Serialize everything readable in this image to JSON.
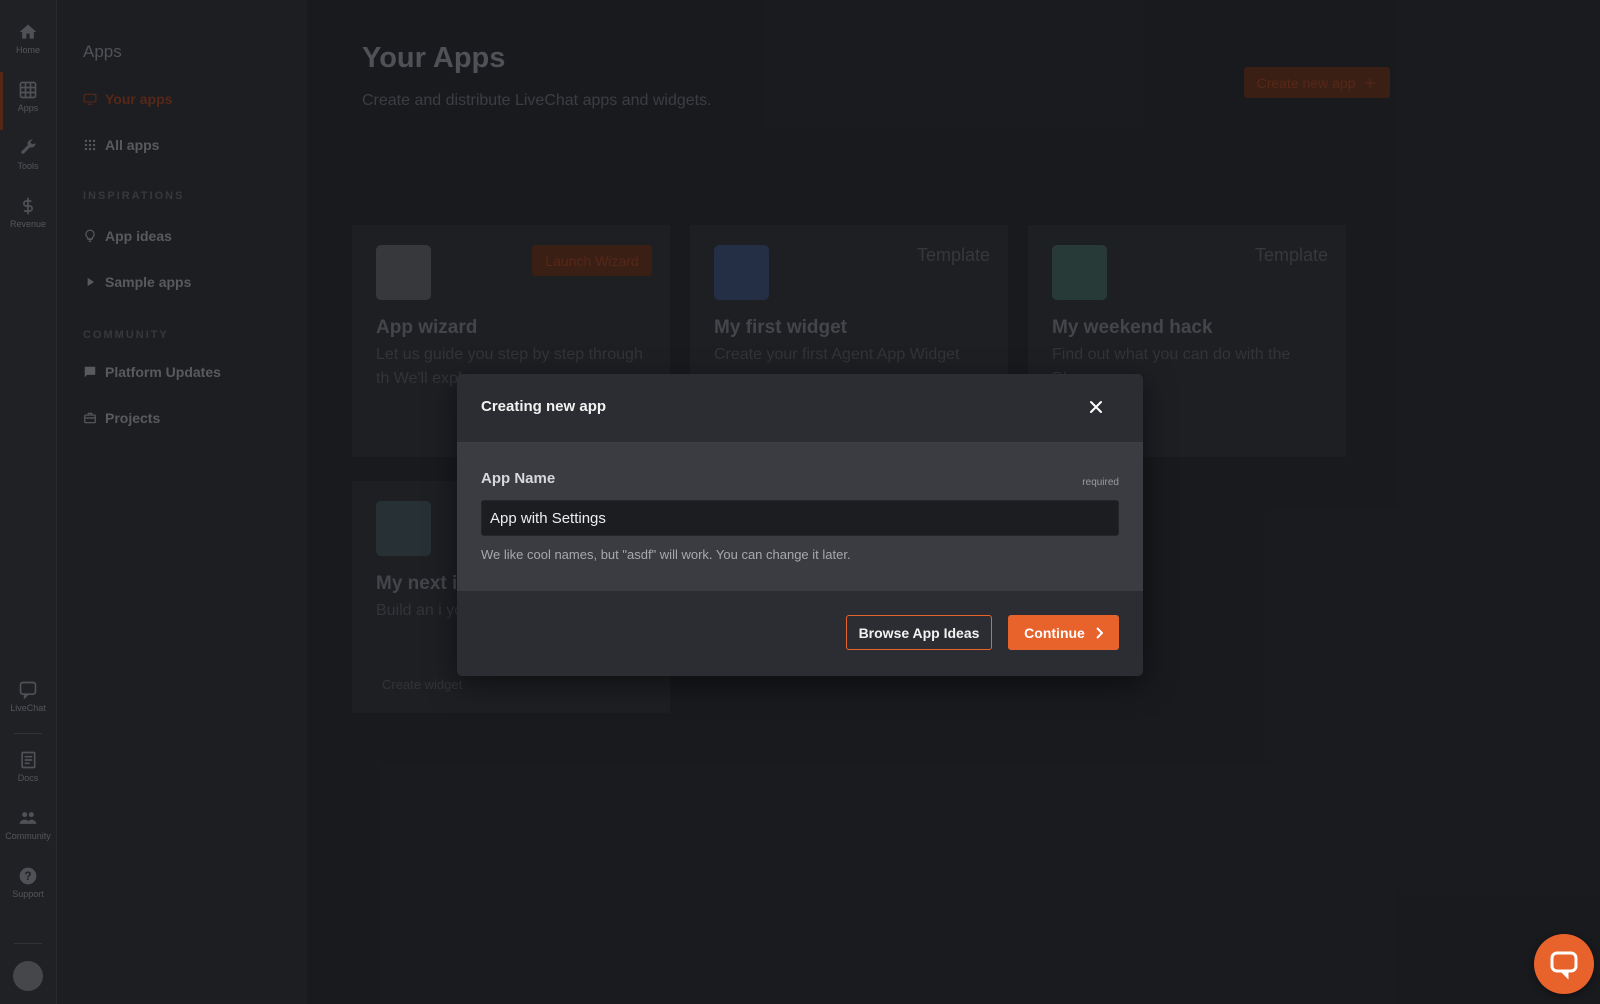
{
  "rail": {
    "items": [
      {
        "label": "Home",
        "icon": "home-icon"
      },
      {
        "label": "Apps",
        "icon": "apps-grid-icon"
      },
      {
        "label": "Tools",
        "icon": "wrench-icon"
      },
      {
        "label": "Revenue",
        "icon": "dollar-icon"
      },
      {
        "label": "LiveChat",
        "icon": "chat-icon"
      },
      {
        "label": "Docs",
        "icon": "docs-icon"
      },
      {
        "label": "Community",
        "icon": "people-icon"
      },
      {
        "label": "Support",
        "icon": "help-icon"
      }
    ]
  },
  "nav": {
    "title": "Apps",
    "your_apps": "Your apps",
    "all_apps": "All apps",
    "inspirations_heading": "INSPIRATIONS",
    "app_ideas": "App ideas",
    "sample_apps": "Sample apps",
    "community_heading": "COMMUNITY",
    "platform_updates": "Platform Updates",
    "projects": "Projects"
  },
  "main": {
    "title": "Your Apps",
    "subtitle": "Create and distribute LiveChat apps and widgets.",
    "create_button": "Create new app",
    "cards": [
      {
        "title": "App wizard",
        "badge": "Launch Wizard",
        "desc": "Let us guide you step by step through th We'll expl"
      },
      {
        "title": "My first widget",
        "badge": "Template",
        "desc": "Create your first Agent App Widget"
      },
      {
        "title": "My weekend hack",
        "badge": "Template",
        "desc": "Find out what you can do with the PIs."
      },
      {
        "title": "My next i",
        "badge": "",
        "desc": "Build an i you alread",
        "link": "Create widget"
      }
    ]
  },
  "modal": {
    "title": "Creating new app",
    "field_label": "App Name",
    "field_required": "required",
    "field_value": "App with Settings",
    "field_hint": "We like cool names, but \"asdf\" will work. You can change it later.",
    "browse_button": "Browse App Ideas",
    "continue_button": "Continue"
  },
  "colors": {
    "accent": "#e8622b",
    "modal_bg": "#2c2d32",
    "modal_body_bg": "#3a3c42",
    "page_bg": "#1b1c20"
  }
}
